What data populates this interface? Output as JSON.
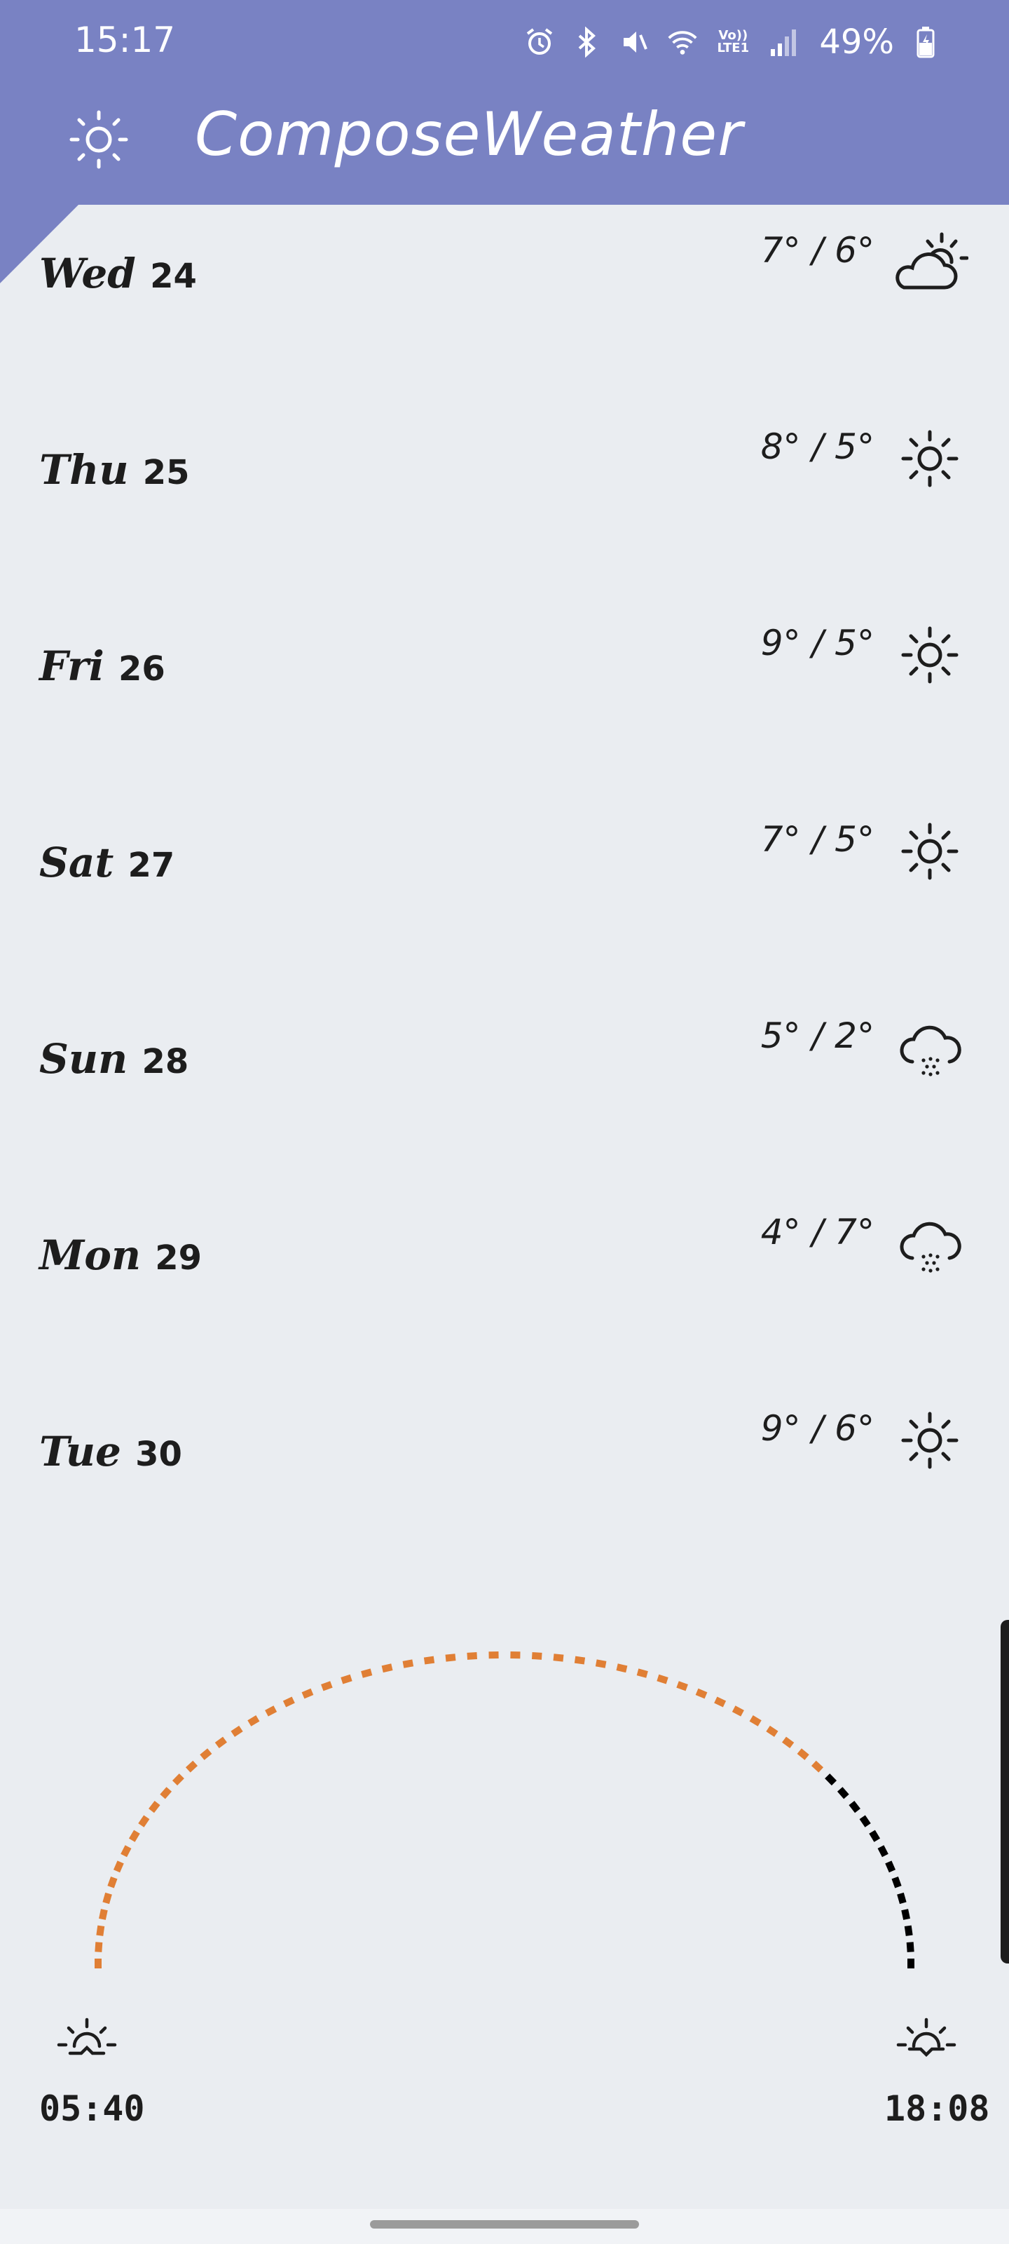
{
  "status_bar": {
    "time": "15:17",
    "battery": "49%",
    "network_label_top": "Vo))",
    "network_label_bottom": "LTE1",
    "icons": [
      "alarm-icon",
      "bluetooth-icon",
      "mute-icon",
      "wifi-icon",
      "volte-icon",
      "signal-icon",
      "battery-charging-icon"
    ]
  },
  "app_bar": {
    "title": "ComposeWeather",
    "icon": "sun-icon",
    "color": "#7982c3"
  },
  "forecast": [
    {
      "day": "Wed",
      "date": "24",
      "temps": "7° / 6°",
      "icon": "partly-cloudy-icon"
    },
    {
      "day": "Thu",
      "date": "25",
      "temps": "8° / 5°",
      "icon": "sun-icon"
    },
    {
      "day": "Fri",
      "date": "26",
      "temps": "9° / 5°",
      "icon": "sun-icon"
    },
    {
      "day": "Sat",
      "date": "27",
      "temps": "7° / 5°",
      "icon": "sun-icon"
    },
    {
      "day": "Sun",
      "date": "28",
      "temps": "5° / 2°",
      "icon": "snow-cloud-icon"
    },
    {
      "day": "Mon",
      "date": "29",
      "temps": "4° / 7°",
      "icon": "snow-cloud-icon"
    },
    {
      "day": "Tue",
      "date": "30",
      "temps": "9° / 6°",
      "icon": "sun-icon"
    }
  ],
  "sun_cycle": {
    "sunrise": "05:40",
    "sunset": "18:08",
    "elapsed_fraction": 0.79,
    "elapsed_color": "#e07f35",
    "remaining_color": "#000000"
  }
}
